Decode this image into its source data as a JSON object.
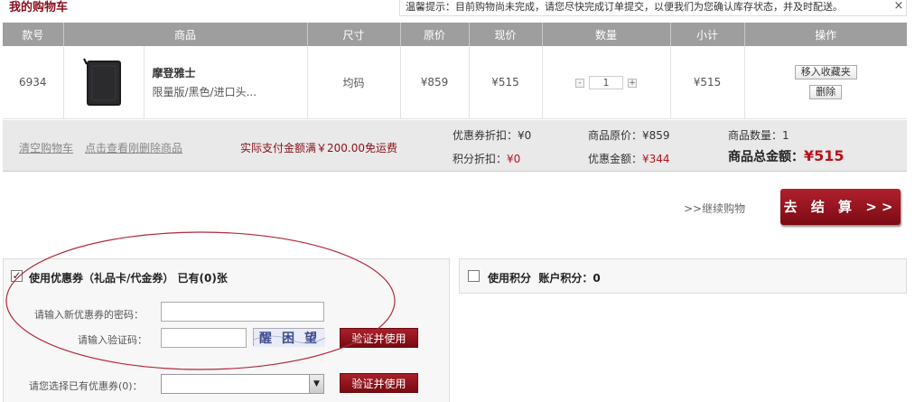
{
  "header": {
    "title": "我的购物车",
    "tip": "温馨提示：目前购物尚未完成，请您尽快完成订单提交，以便我们为您确认库存状态，并及时配送。",
    "close": "×"
  },
  "table": {
    "columns": [
      "款号",
      "商品",
      "尺寸",
      "原价",
      "现价",
      "数量",
      "小计",
      "操作"
    ],
    "row": {
      "sku": "6934",
      "product_name": "摩登雅士",
      "product_desc": "限量版/黑色/进口头...",
      "size": "均码",
      "original_price": "¥859",
      "current_price": "¥515",
      "quantity": "1",
      "qty_minus": "-",
      "qty_plus": "+",
      "subtotal": "¥515",
      "actions": [
        "移入收藏夹",
        "删除"
      ]
    }
  },
  "summary": {
    "clear_cart": "清空购物车",
    "view_deleted": "点击查看刚删除商品",
    "free_shipping": "实际支付金额满￥200.00免运费",
    "coupon_discount_label": "优惠券折扣：",
    "coupon_discount_value": "¥0",
    "points_discount_label": "积分折扣：",
    "points_discount_value": "¥0",
    "original_total_label": "商品原价：",
    "original_total_value": "¥859",
    "discount_amount_label": "优惠金额：",
    "discount_amount_value": "¥344",
    "item_count_label": "商品数量：",
    "item_count_value": "1",
    "grand_total_label": "商品总金额：",
    "grand_total_value": "¥515"
  },
  "actions": {
    "continue_shopping": ">>继续购物",
    "checkout": "去 结 算 >>"
  },
  "coupon": {
    "checked": true,
    "title": "使用优惠券（礼品卡/代金券） 已有(0)张",
    "password_label": "请输入新优惠券的密码：",
    "captcha_label": "请输入验证码：",
    "verify_button": "验证并使用",
    "select_label": "请您选择已有优惠券(0)：",
    "select_verify_button": "验证并使用"
  },
  "points": {
    "checked": false,
    "title": "使用积分",
    "account_label": "账户积分：",
    "account_value": "0"
  },
  "colors": {
    "brand_red": "#8a0f1d",
    "price_red": "#b8121d",
    "header_gray": "#9e9e9e",
    "summary_bg": "#e9e9e9"
  }
}
